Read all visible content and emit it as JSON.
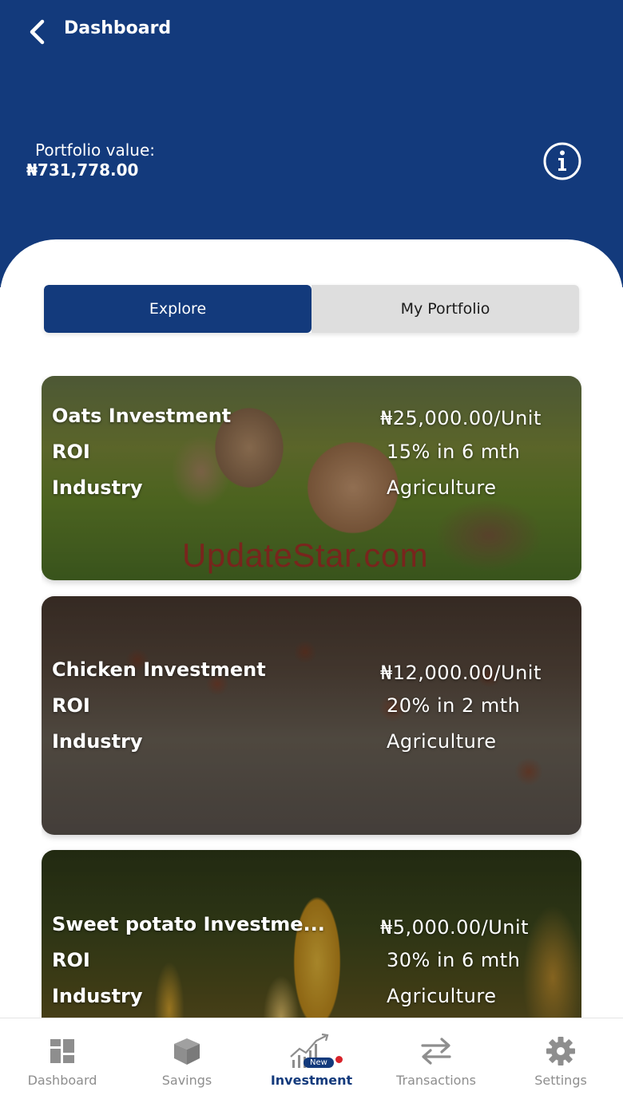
{
  "header": {
    "title": "Dashboard",
    "portfolio_label": "Portfolio value:",
    "portfolio_value": "₦731,778.00"
  },
  "tabs": {
    "explore": "Explore",
    "portfolio": "My Portfolio",
    "active": "Explore"
  },
  "investments": [
    {
      "name": "Oats Investment",
      "price": "₦25,000.00/Unit",
      "roi_label": "ROI",
      "roi": "15% in 6 mth",
      "industry_label": "Industry",
      "industry": "Agriculture"
    },
    {
      "name": "Chicken Investment",
      "price": "₦12,000.00/Unit",
      "roi_label": "ROI",
      "roi": "20% in 2 mth",
      "industry_label": "Industry",
      "industry": "Agriculture"
    },
    {
      "name": "Sweet potato Investme...",
      "price": "₦5,000.00/Unit",
      "roi_label": "ROI",
      "roi": "30% in 6 mth",
      "industry_label": "Industry",
      "industry": "Agriculture"
    }
  ],
  "watermark": "UpdateStar.com",
  "bottom_nav": {
    "items": [
      {
        "label": "Dashboard",
        "icon": "dashboard-icon"
      },
      {
        "label": "Savings",
        "icon": "box-icon"
      },
      {
        "label": "Investment",
        "icon": "chart-icon",
        "badge": "New",
        "active": true
      },
      {
        "label": "Transactions",
        "icon": "swap-icon"
      },
      {
        "label": "Settings",
        "icon": "gear-icon"
      }
    ]
  },
  "colors": {
    "primary": "#133a7c",
    "tab_inactive": "#dedede",
    "nav_inactive": "#8e8e8e",
    "badge_dot": "#d8232a"
  }
}
